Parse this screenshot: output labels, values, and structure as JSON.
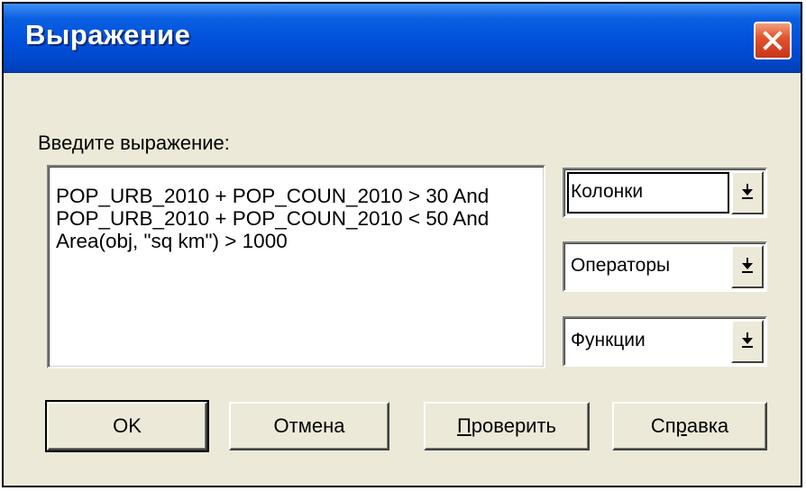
{
  "window": {
    "title": "Выражение",
    "close_icon": "close-icon",
    "title_colors": {
      "top": "#3d8ef6",
      "mid": "#0050dc",
      "bottom": "#003fb4"
    },
    "close_color": "#e3552d",
    "face_color": "#ece9d8"
  },
  "prompt": "Введите выражение:",
  "expression": "POP_URB_2010 + POP_COUN_2010 > 30 And POP_URB_2010 + POP_COUN_2010 < 50 And Area(obj, \"sq km\") > 1000",
  "dropdowns": [
    {
      "label": "Колонки",
      "icon": "dropdown-arrow-icon",
      "focused": true
    },
    {
      "label": "Операторы",
      "icon": "dropdown-arrow-icon",
      "focused": false
    },
    {
      "label": "Функции",
      "icon": "dropdown-arrow-icon",
      "focused": false
    }
  ],
  "buttons": {
    "ok": {
      "label": "OK"
    },
    "cancel": {
      "label": "Отмена"
    },
    "verify": {
      "pre": "",
      "accel": "П",
      "post": "роверить"
    },
    "help": {
      "pre": "Сп",
      "accel": "р",
      "post": "авка"
    }
  }
}
